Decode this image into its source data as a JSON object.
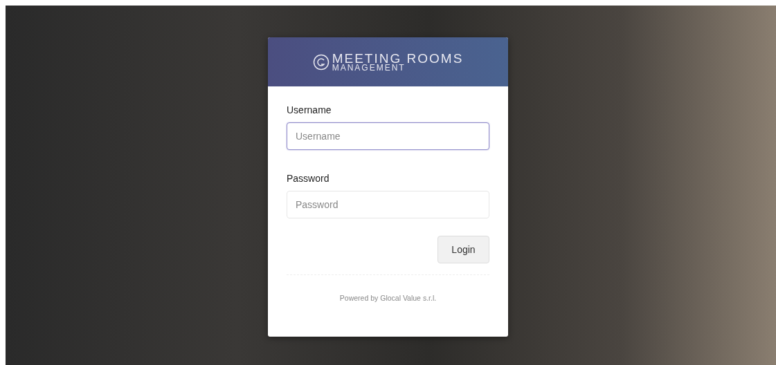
{
  "logo": {
    "title": "MEETING ROOMS",
    "subtitle": "MANAGEMENT"
  },
  "fields": [
    {
      "label": "Username",
      "placeholder": "Username",
      "focused": true
    },
    {
      "label": "Password",
      "placeholder": "Password",
      "focused": false
    }
  ],
  "button": "Login",
  "footer": "Powered by Glocal Value s.r.l."
}
